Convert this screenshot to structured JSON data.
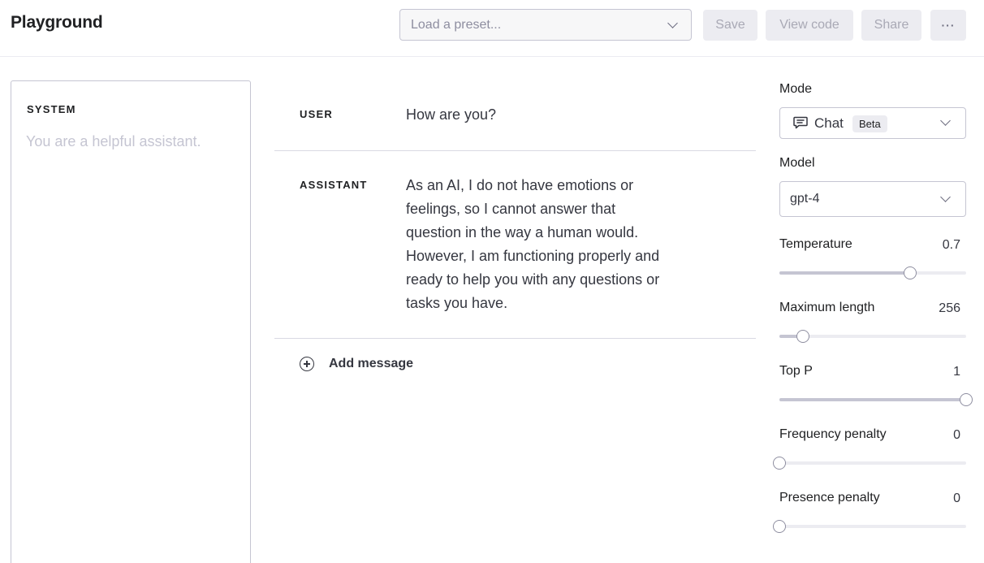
{
  "header": {
    "title": "Playground",
    "preset_placeholder": "Load a preset...",
    "save_label": "Save",
    "view_code_label": "View code",
    "share_label": "Share",
    "more_label": "···"
  },
  "system": {
    "label": "SYSTEM",
    "placeholder": "You are a helpful assistant."
  },
  "messages": [
    {
      "role": "USER",
      "text": "How are you?"
    },
    {
      "role": "ASSISTANT",
      "lines": [
        "As an AI, I do not have emotions or",
        "feelings, so I cannot answer that",
        "question in the way a human would.",
        "However, I am functioning properly and",
        "ready to help you with any questions or",
        "tasks you have."
      ]
    }
  ],
  "add_message_label": "Add message",
  "settings": {
    "mode": {
      "label": "Mode",
      "value": "Chat",
      "badge": "Beta",
      "icon": "chat-bubble-icon"
    },
    "model": {
      "label": "Model",
      "value": "gpt-4"
    },
    "temperature": {
      "label": "Temperature",
      "value": "0.7",
      "fraction": 0.7
    },
    "max_length": {
      "label": "Maximum length",
      "value": "256",
      "fraction": 0.125
    },
    "top_p": {
      "label": "Top P",
      "value": "1",
      "fraction": 1.0
    },
    "frequency_penalty": {
      "label": "Frequency penalty",
      "value": "0",
      "fraction": 0.0
    },
    "presence_penalty": {
      "label": "Presence penalty",
      "value": "0",
      "fraction": 0.0
    }
  },
  "colors": {
    "accent": "#10a37f",
    "border": "#c5c5d2",
    "muted": "#8e8ea0",
    "placeholder": "#c5c5d2"
  }
}
